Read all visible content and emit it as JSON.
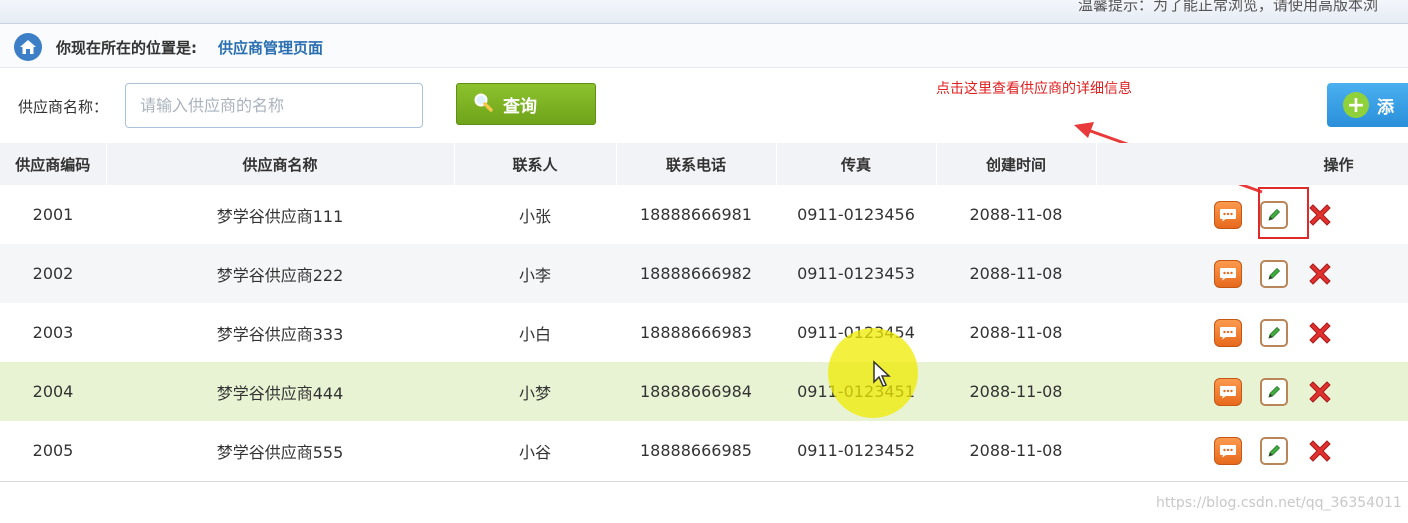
{
  "top_tip": "温馨提示：为了能正常浏览，请使用高版本浏",
  "location": {
    "label": "你现在所在的位置是:",
    "value": "供应商管理页面"
  },
  "search": {
    "label": "供应商名称：",
    "placeholder": "请输入供应商的名称",
    "query_label": "查询",
    "add_label": "添"
  },
  "annotation": "点击这里查看供应商的详细信息",
  "table": {
    "headers": [
      "供应商编码",
      "供应商名称",
      "联系人",
      "联系电话",
      "传真",
      "创建时间",
      "操作"
    ],
    "rows": [
      {
        "code": "2001",
        "name": "梦学谷供应商111",
        "contact": "小张",
        "phone": "18888666981",
        "fax": "0911-0123456",
        "created": "2088-11-08"
      },
      {
        "code": "2002",
        "name": "梦学谷供应商222",
        "contact": "小李",
        "phone": "18888666982",
        "fax": "0911-0123453",
        "created": "2088-11-08"
      },
      {
        "code": "2003",
        "name": "梦学谷供应商333",
        "contact": "小白",
        "phone": "18888666983",
        "fax": "0911-0123454",
        "created": "2088-11-08"
      },
      {
        "code": "2004",
        "name": "梦学谷供应商444",
        "contact": "小梦",
        "phone": "18888666984",
        "fax": "0911-0123451",
        "created": "2088-11-08"
      },
      {
        "code": "2005",
        "name": "梦学谷供应商555",
        "contact": "小谷",
        "phone": "18888666985",
        "fax": "0911-0123452",
        "created": "2088-11-08"
      }
    ]
  },
  "watermark": "https://blog.csdn.net/qq_36354011",
  "colors": {
    "accent_blue": "#2a6fb1",
    "query_green": "#7fb325",
    "annotation_red": "#e02020",
    "highlight_row": "#e8f3d4"
  }
}
